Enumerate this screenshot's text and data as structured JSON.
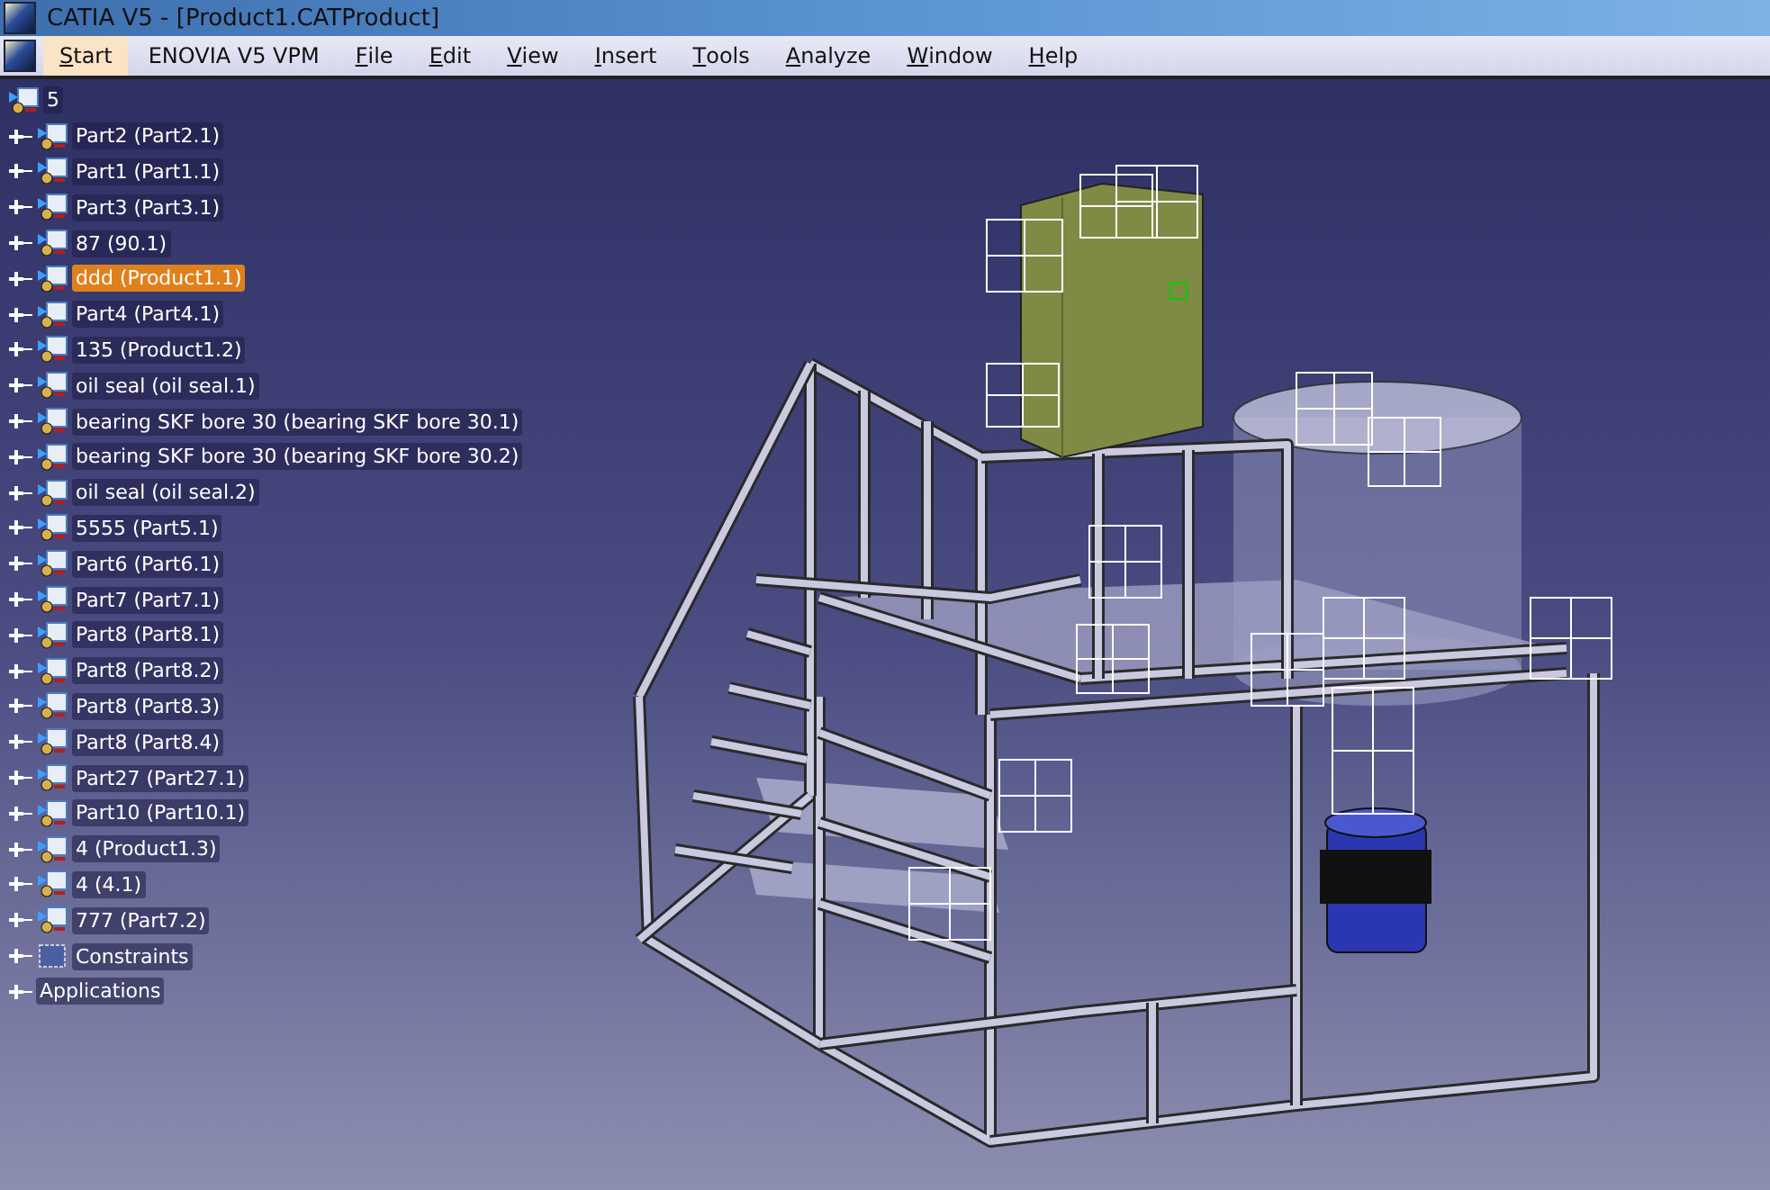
{
  "window": {
    "title": "CATIA V5 - [Product1.CATProduct]"
  },
  "menu": [
    {
      "label": "Start",
      "selected": true,
      "mnemonic": true
    },
    {
      "label": "ENOVIA V5 VPM",
      "selected": false,
      "mnemonic": false
    },
    {
      "label": "File",
      "selected": false,
      "mnemonic": true
    },
    {
      "label": "Edit",
      "selected": false,
      "mnemonic": true
    },
    {
      "label": "View",
      "selected": false,
      "mnemonic": true
    },
    {
      "label": "Insert",
      "selected": false,
      "mnemonic": true
    },
    {
      "label": "Tools",
      "selected": false,
      "mnemonic": true
    },
    {
      "label": "Analyze",
      "selected": false,
      "mnemonic": true
    },
    {
      "label": "Window",
      "selected": false,
      "mnemonic": true
    },
    {
      "label": "Help",
      "selected": false,
      "mnemonic": true
    }
  ],
  "tree": {
    "root": "5",
    "items": [
      {
        "label": "Part2 (Part2.1)",
        "kind": "part",
        "selected": false
      },
      {
        "label": "Part1 (Part1.1)",
        "kind": "part",
        "selected": false
      },
      {
        "label": "Part3 (Part3.1)",
        "kind": "part",
        "selected": false
      },
      {
        "label": "87 (90.1)",
        "kind": "product",
        "selected": false
      },
      {
        "label": "ddd (Product1.1)",
        "kind": "product",
        "selected": true
      },
      {
        "label": "Part4 (Part4.1)",
        "kind": "part",
        "selected": false
      },
      {
        "label": "135 (Product1.2)",
        "kind": "product",
        "selected": false
      },
      {
        "label": "oil seal (oil seal.1)",
        "kind": "product",
        "selected": false
      },
      {
        "label": "bearing SKF bore 30 (bearing SKF bore 30.1)",
        "kind": "part",
        "selected": false
      },
      {
        "label": "bearing SKF bore 30 (bearing SKF bore 30.2)",
        "kind": "part",
        "selected": false
      },
      {
        "label": "oil seal (oil seal.2)",
        "kind": "product",
        "selected": false
      },
      {
        "label": "5555 (Part5.1)",
        "kind": "part",
        "selected": false
      },
      {
        "label": "Part6 (Part6.1)",
        "kind": "part",
        "selected": false
      },
      {
        "label": "Part7 (Part7.1)",
        "kind": "part",
        "selected": false
      },
      {
        "label": "Part8 (Part8.1)",
        "kind": "part",
        "selected": false
      },
      {
        "label": "Part8 (Part8.2)",
        "kind": "part",
        "selected": false
      },
      {
        "label": "Part8 (Part8.3)",
        "kind": "part",
        "selected": false
      },
      {
        "label": "Part8 (Part8.4)",
        "kind": "part",
        "selected": false
      },
      {
        "label": "Part27 (Part27.1)",
        "kind": "part",
        "selected": false
      },
      {
        "label": "Part10 (Part10.1)",
        "kind": "part",
        "selected": false
      },
      {
        "label": "4 (Product1.3)",
        "kind": "product",
        "selected": false
      },
      {
        "label": "4 (4.1)",
        "kind": "product",
        "selected": false
      },
      {
        "label": "777 (Part7.2)",
        "kind": "product",
        "selected": false
      },
      {
        "label": "Constraints",
        "kind": "constraints",
        "selected": false
      },
      {
        "label": "Applications",
        "kind": "applications",
        "selected": false
      }
    ]
  }
}
